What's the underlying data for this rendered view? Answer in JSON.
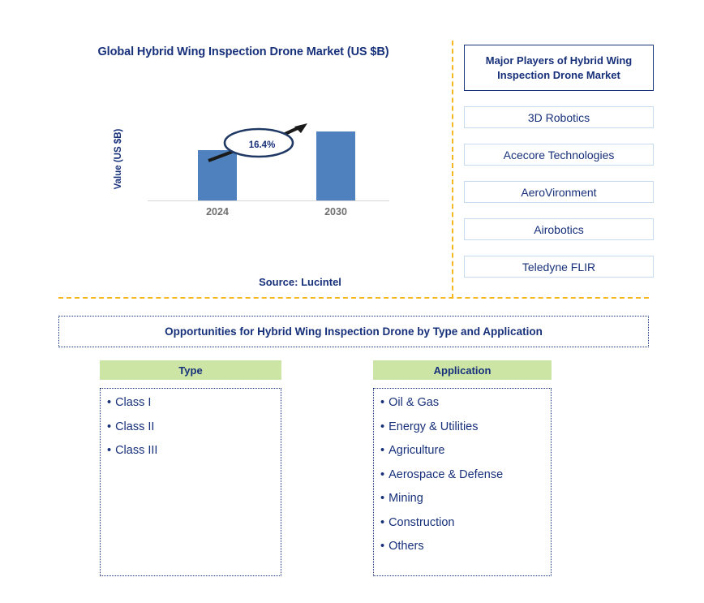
{
  "chart_panel": {
    "title": "Global Hybrid Wing Inspection Drone Market (US $B)",
    "source": "Source: Lucintel",
    "cagr_label": "16.4%"
  },
  "players_panel": {
    "header": "Major Players of Hybrid Wing Inspection Drone Market",
    "items": [
      {
        "label": "3D Robotics"
      },
      {
        "label": "Acecore Technologies"
      },
      {
        "label": "AeroVironment"
      },
      {
        "label": "Airobotics"
      },
      {
        "label": "Teledyne FLIR"
      }
    ]
  },
  "opportunities": {
    "title": "Opportunities for Hybrid Wing Inspection Drone by Type and Application",
    "columns": [
      {
        "header": "Type",
        "items": [
          "Class I",
          "Class II",
          "Class III"
        ]
      },
      {
        "header": "Application",
        "items": [
          "Oil & Gas",
          "Energy & Utilities",
          "Agriculture",
          "Aerospace & Defense",
          "Mining",
          "Construction",
          "Others"
        ]
      }
    ]
  },
  "colors": {
    "bar": "#4e81bd",
    "navy": "#17307a",
    "gold_divider": "#f5b820",
    "green_header": "#cce5a5",
    "tick_gray": "#6f6f6f"
  },
  "chart_data": {
    "type": "bar",
    "title": "Global Hybrid Wing Inspection Drone Market (US $B)",
    "xlabel": "",
    "ylabel": "Value (US $B)",
    "categories": [
      "2024",
      "2030"
    ],
    "values": [
      62,
      85
    ],
    "ylim": [
      0,
      108
    ],
    "grid": false,
    "legend": false,
    "annotations": [
      {
        "text": "16.4%",
        "kind": "cagr-callout",
        "from": "2024",
        "to": "2030"
      }
    ],
    "bar_color": "#4e81bd",
    "source": "Source: Lucintel"
  }
}
